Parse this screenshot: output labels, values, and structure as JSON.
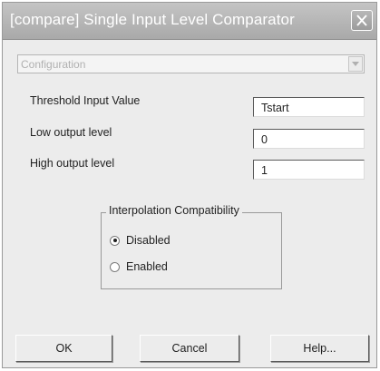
{
  "window": {
    "title": "[compare] Single Input Level Comparator"
  },
  "config": {
    "selected": "Configuration"
  },
  "fields": [
    {
      "label": "Threshold Input Value",
      "value": "Tstart"
    },
    {
      "label": "Low output level",
      "value": "0"
    },
    {
      "label": "High output level",
      "value": "1"
    }
  ],
  "interpolation": {
    "title": "Interpolation Compatibility",
    "options": [
      {
        "label": "Disabled",
        "checked": true
      },
      {
        "label": "Enabled",
        "checked": false
      }
    ]
  },
  "buttons": {
    "ok": "OK",
    "cancel": "Cancel",
    "help": "Help..."
  },
  "icons": {
    "close": "close-icon",
    "dropdown": "chevron-down-icon"
  }
}
